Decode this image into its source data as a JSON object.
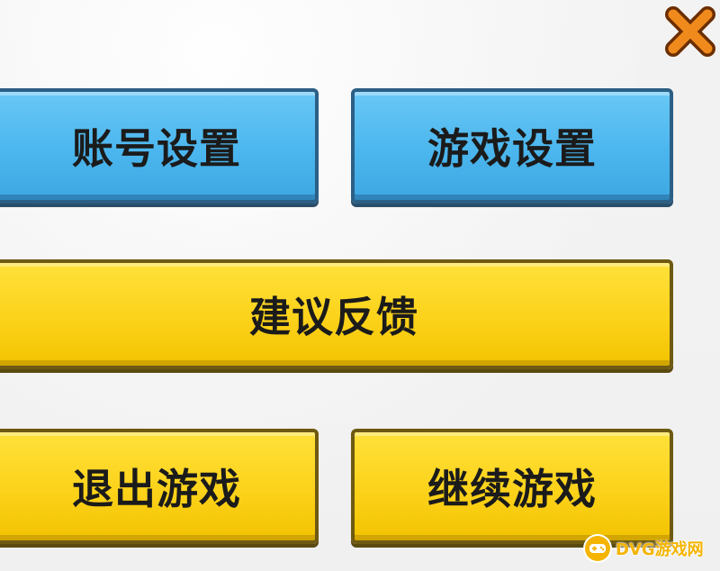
{
  "buttons": {
    "account_settings": "账号设置",
    "game_settings": "游戏设置",
    "feedback": "建议反馈",
    "quit_game": "退出游戏",
    "continue_game": "继续游戏"
  },
  "watermark": {
    "text": "DVG游戏网"
  },
  "colors": {
    "blue_button": "#4bb6ee",
    "yellow_button": "#fcd21a",
    "close_orange": "#f08a1c"
  },
  "icons": {
    "close": "close-x-icon",
    "watermark_logo": "gamepad-icon"
  }
}
